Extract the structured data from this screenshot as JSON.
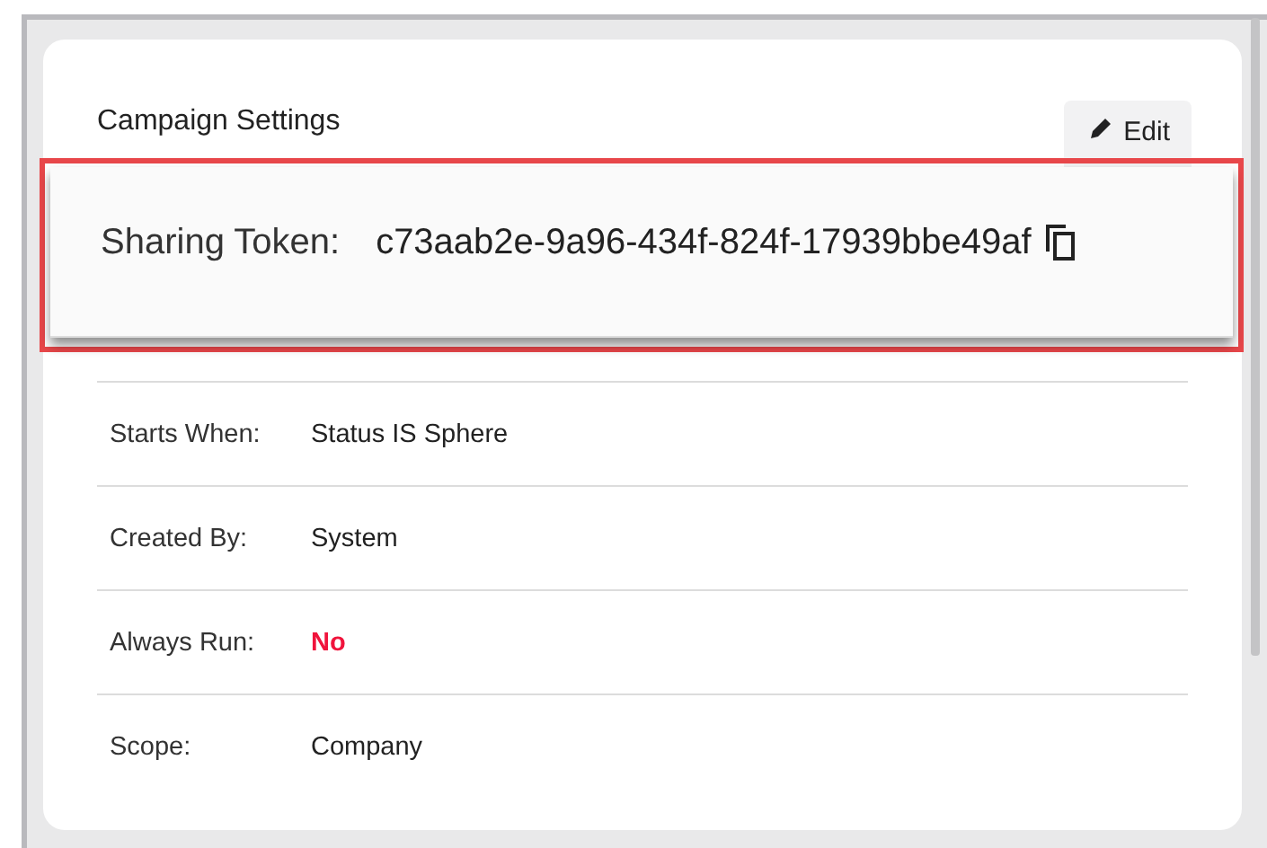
{
  "card": {
    "title": "Campaign Settings",
    "edit_button": "Edit"
  },
  "rows": [
    {
      "label": "Starts When:",
      "value": "Status IS Sphere",
      "kind": "plain"
    },
    {
      "label": "Created By:",
      "value": "System",
      "kind": "plain"
    },
    {
      "label": "Always Run:",
      "value": "No",
      "kind": "alert"
    },
    {
      "label": "Scope:",
      "value": "Company",
      "kind": "plain"
    }
  ],
  "token_popup": {
    "label": "Sharing Token:",
    "value": "c73aab2e-9a96-434f-824f-17939bbe49af"
  }
}
